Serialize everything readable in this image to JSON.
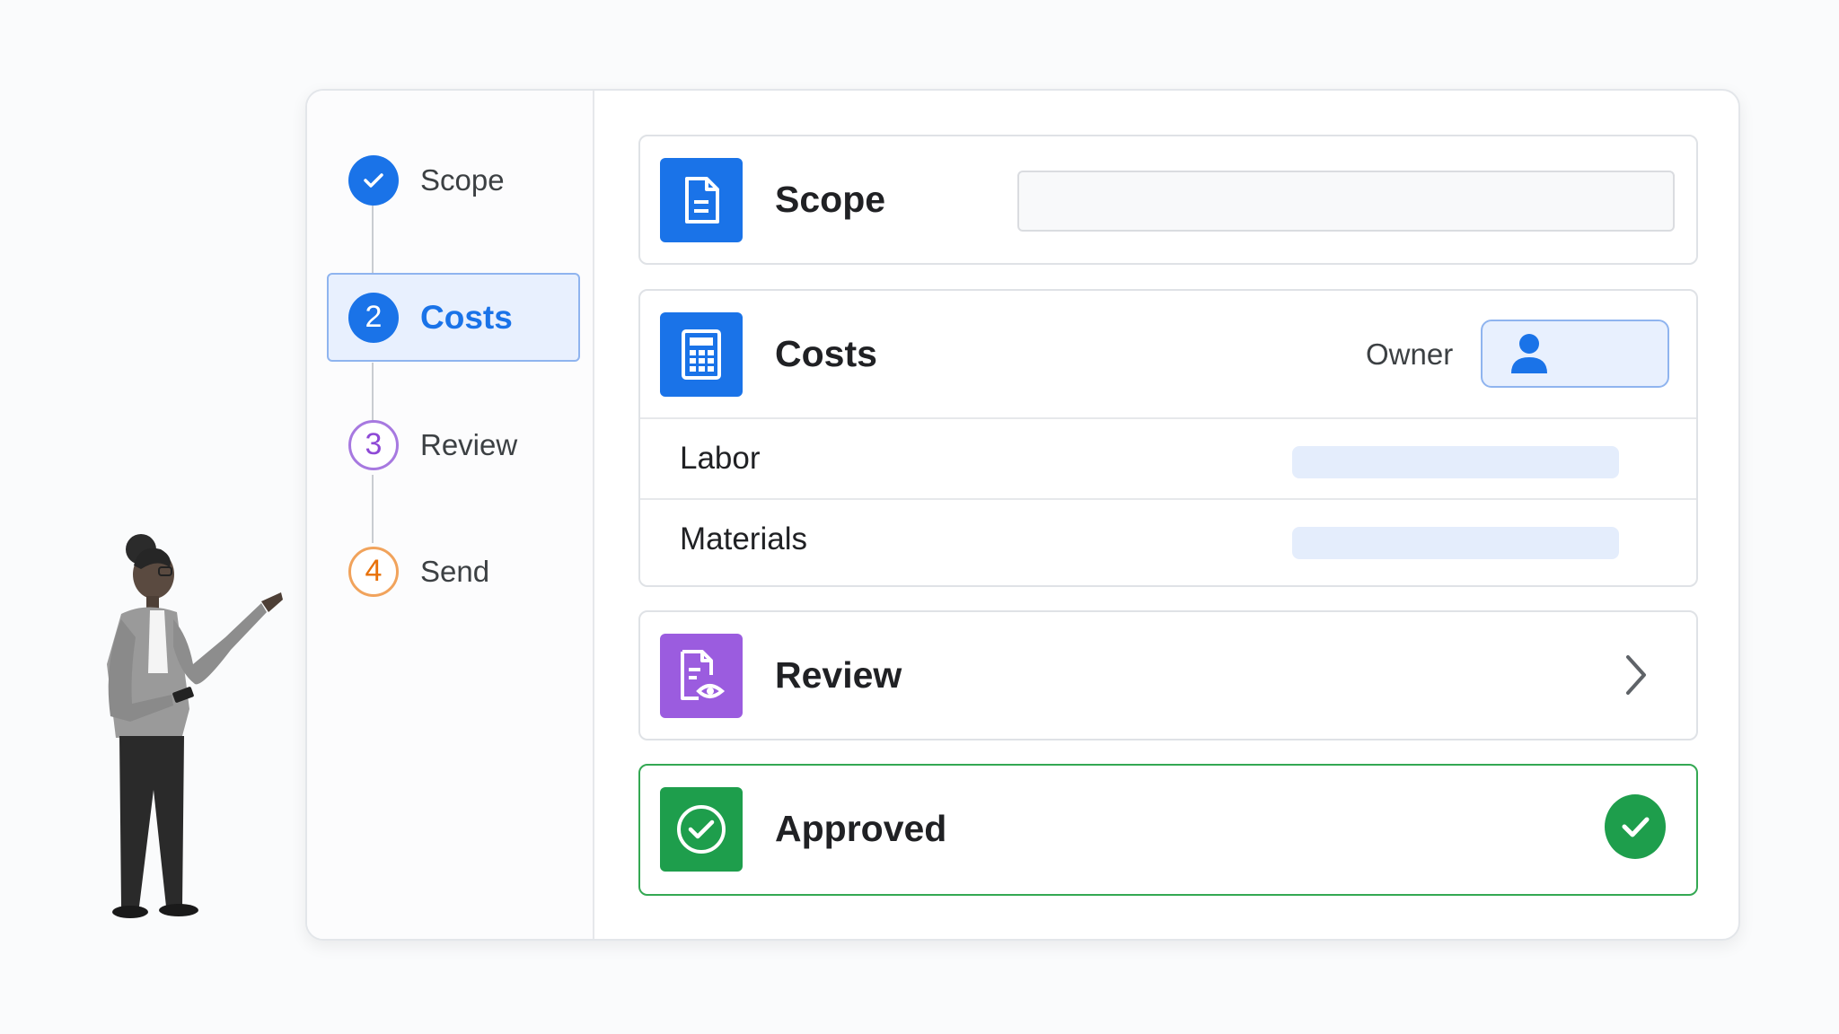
{
  "steps": [
    {
      "label": "Scope",
      "state": "done"
    },
    {
      "number": "2",
      "label": "Costs",
      "state": "current"
    },
    {
      "number": "3",
      "label": "Review",
      "state": "pending"
    },
    {
      "number": "4",
      "label": "Send",
      "state": "pending"
    }
  ],
  "cards": {
    "scope": {
      "title": "Scope",
      "icon": "document-icon",
      "field_value": ""
    },
    "costs": {
      "title": "Costs",
      "icon": "calculator-icon",
      "owner_label": "Owner",
      "rows": [
        {
          "label": "Labor",
          "value": ""
        },
        {
          "label": "Materials",
          "value": ""
        }
      ]
    },
    "review": {
      "title": "Review",
      "icon": "document-review-icon"
    },
    "approved": {
      "title": "Approved",
      "icon": "check-circle-icon"
    }
  },
  "colors": {
    "accent": "#1a73e8",
    "review": "#9b5cdf",
    "approved": "#1e9e4c",
    "send": "#e8710a"
  }
}
